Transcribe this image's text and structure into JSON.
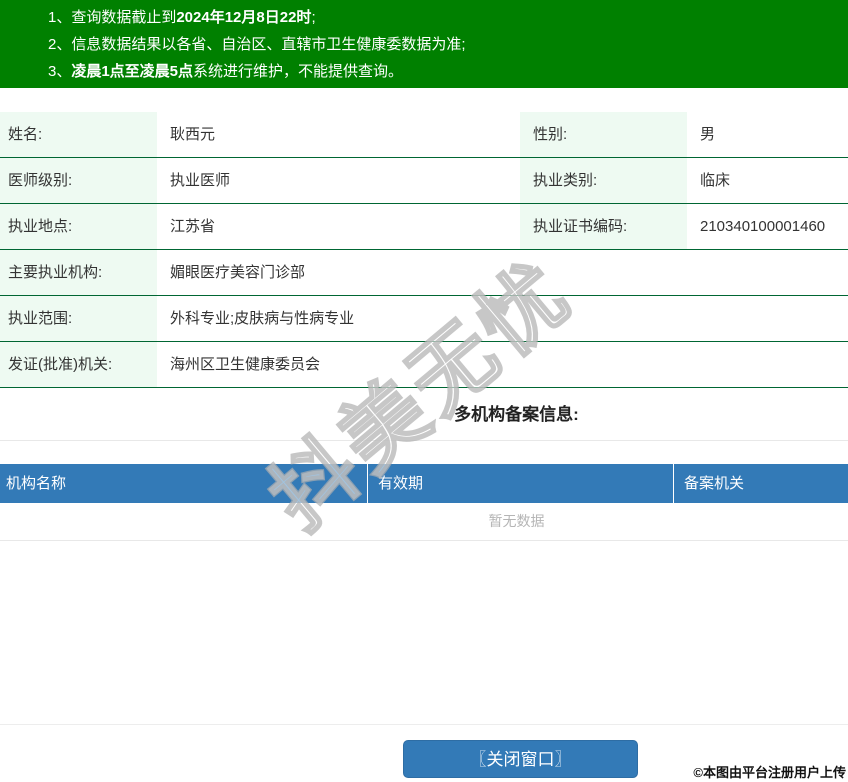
{
  "notice": {
    "lines": [
      {
        "segments": [
          {
            "text": "1、查询数据截止到",
            "bold": false
          },
          {
            "text": "2024年12月8日22时",
            "bold": true
          },
          {
            "text": ";",
            "bold": false
          }
        ]
      },
      {
        "segments": [
          {
            "text": "2、信息数据结果以各省、自治区、直辖市卫生健康委数据为准;",
            "bold": false
          }
        ]
      },
      {
        "segments": [
          {
            "text": "3、",
            "bold": false
          },
          {
            "text": "凌晨1点至凌晨5点",
            "bold": true
          },
          {
            "text": "系统进行维护，不能提供查询。",
            "bold": false
          }
        ]
      }
    ]
  },
  "profile": {
    "rows": [
      {
        "cells": [
          {
            "label": "姓名:",
            "value": "耿西元"
          },
          {
            "label": "性别:",
            "value": "男"
          }
        ]
      },
      {
        "cells": [
          {
            "label": "医师级别:",
            "value": "执业医师"
          },
          {
            "label": "执业类别:",
            "value": "临床"
          }
        ]
      },
      {
        "cells": [
          {
            "label": "执业地点:",
            "value": "江苏省"
          },
          {
            "label": "执业证书编码:",
            "value": "210340100001460"
          }
        ]
      },
      {
        "cells": [
          {
            "label": "主要执业机构:",
            "value": "媚眼医疗美容门诊部"
          }
        ]
      },
      {
        "cells": [
          {
            "label": "执业范围:",
            "value": "外科专业;皮肤病与性病专业"
          }
        ]
      },
      {
        "cells": [
          {
            "label": "发证(批准)机关:",
            "value": "海州区卫生健康委员会"
          }
        ]
      }
    ]
  },
  "filing": {
    "title": "多机构备案信息:",
    "columns": [
      "机构名称",
      "有效期",
      "备案机关"
    ],
    "empty_text": "暂无数据"
  },
  "footer": {
    "close_button": "〖关闭窗口〗",
    "copyright": "©本图由平台注册用户上传"
  },
  "watermark": {
    "text": "抖美无忧"
  },
  "colors": {
    "notice_bg": "#008000",
    "row_border": "#006633",
    "label_bg": "#eefaf2",
    "header_blue": "#337ab7",
    "divider": "#e8e8e8",
    "empty_text": "#b5b5b5"
  }
}
